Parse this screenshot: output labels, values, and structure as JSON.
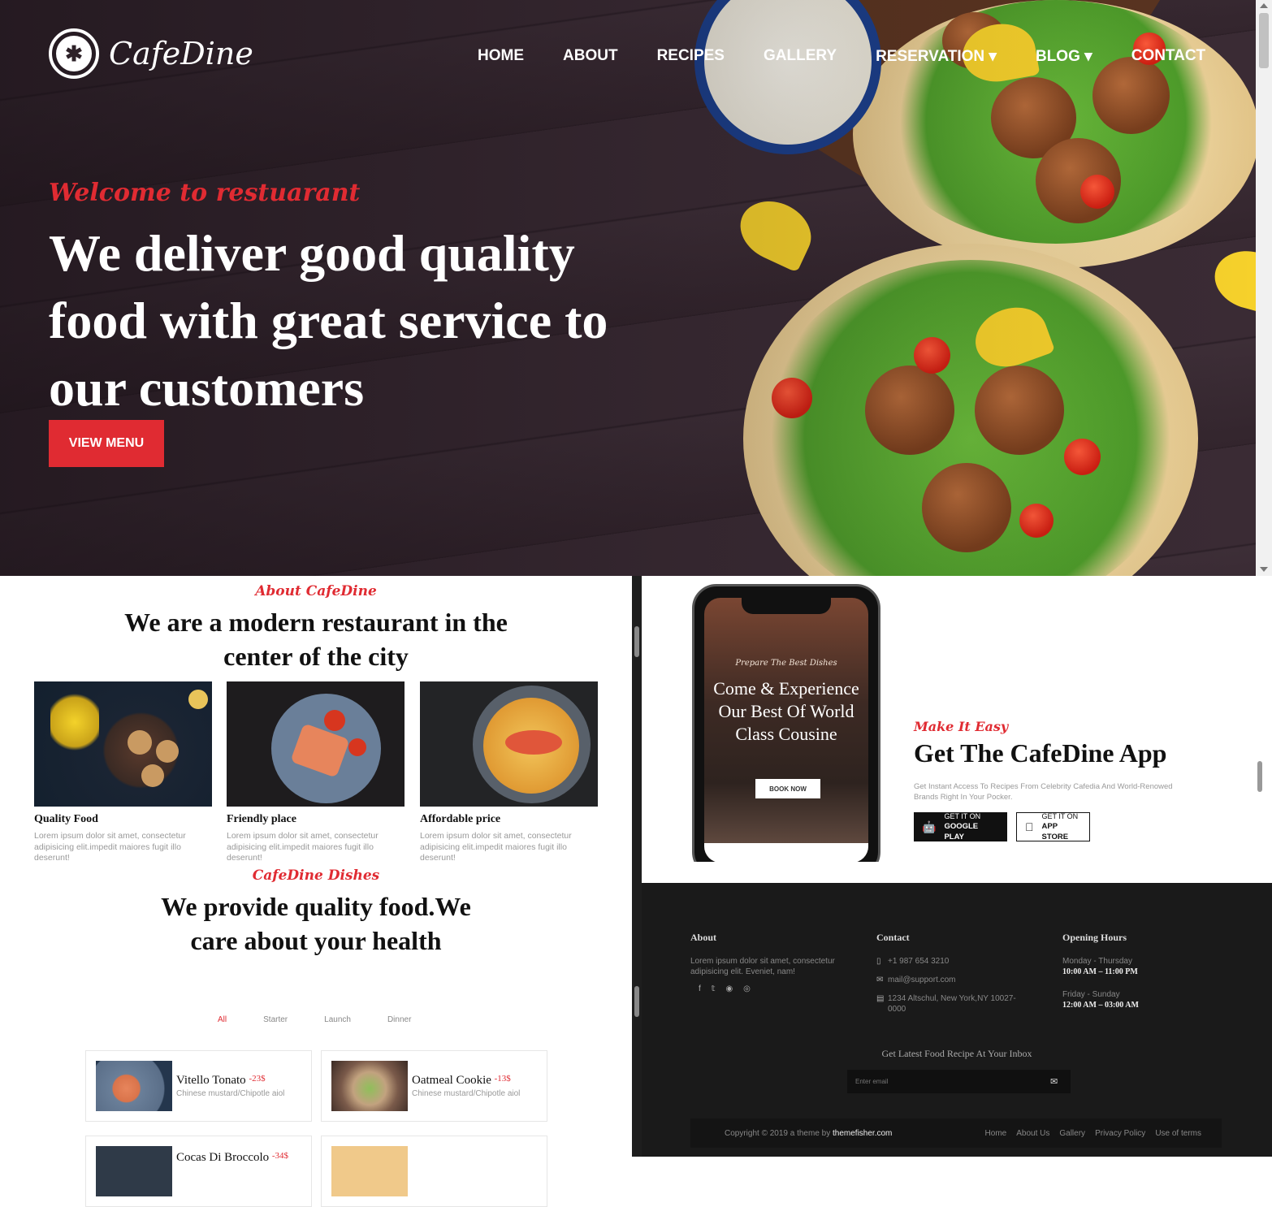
{
  "brand": {
    "name": "CafeDine",
    "accent": "#e02b32"
  },
  "nav": {
    "items": [
      "HOME",
      "ABOUT",
      "RECIPES",
      "GALLERY",
      "RESERVATION",
      "BLOG",
      "CONTACT"
    ]
  },
  "hero": {
    "welcome": "Welcome to restuarant",
    "title": "We deliver good quality food with great service to our customers",
    "cta": "VIEW MENU"
  },
  "about": {
    "subtitle": "About CafeDine",
    "title": "We are a modern restaurant in the center of the city",
    "features": [
      {
        "title": "Quality Food",
        "text": "Lorem ipsum dolor sit amet, consectetur adipisicing elit.impedit maiores fugit illo deserunt!"
      },
      {
        "title": "Friendly place",
        "text": "Lorem ipsum dolor sit amet, consectetur adipisicing elit.impedit maiores fugit illo deserunt!"
      },
      {
        "title": "Affordable price",
        "text": "Lorem ipsum dolor sit amet, consectetur adipisicing elit.impedit maiores fugit illo deserunt!"
      }
    ]
  },
  "dishes": {
    "subtitle": "CafeDine Dishes",
    "title": "We provide quality food.We care about your health",
    "tabs": [
      "All",
      "Starter",
      "Launch",
      "Dinner"
    ],
    "items": [
      {
        "name": "Vitello Tonato",
        "price": "-23$",
        "desc": "Chinese mustard/Chipotle aiol"
      },
      {
        "name": "Oatmeal Cookie",
        "price": "-13$",
        "desc": "Chinese mustard/Chipotle aiol"
      },
      {
        "name": "Cocas Di Broccolo",
        "price": "-34$",
        "desc": ""
      },
      {
        "name": "",
        "price": "",
        "desc": ""
      }
    ]
  },
  "app": {
    "phone_subtitle": "Prepare The Best Dishes",
    "phone_title": "Come & Experience Our Best Of World Class Cousine",
    "phone_button": "BOOK NOW",
    "subtitle": "Make It Easy",
    "title": "Get The CafeDine App",
    "desc": "Get Instant Access To Recipes From Celebrity Cafedia And World-Renowed Brands Right In Your Pocker.",
    "google": {
      "line1": "GET IT ON",
      "line2": "GOOGLE PLAY",
      "icon": "android-icon"
    },
    "apple": {
      "line1": "GET IT ON",
      "line2": "APP STORE",
      "icon": "apple-icon"
    }
  },
  "footer": {
    "about_title": "About",
    "about_text": "Lorem ipsum dolor sit amet, consectetur adipisicing elit. Eveniet, nam!",
    "social": [
      "facebook-icon",
      "twitter-icon",
      "github-icon",
      "dribbble-icon"
    ],
    "contact_title": "Contact",
    "phone": "+1 987 654 3210",
    "email": "mail@support.com",
    "address": "1234 Altschul, New York,NY 10027-0000",
    "hours_title": "Opening Hours",
    "hours": [
      {
        "days": "Monday - Thursday",
        "time": "10:00 AM – 11:00 PM"
      },
      {
        "days": "Friday - Sunday",
        "time": "12:00 AM – 03:00 AM"
      }
    ],
    "newsletter_title": "Get Latest Food Recipe At Your Inbox",
    "newsletter_placeholder": "Enter email",
    "copyright_prefix": "Copyright © 2019 a theme by",
    "copyright_author": "themefisher.com",
    "links": [
      "Home",
      "About Us",
      "Gallery",
      "Privacy Policy",
      "Use of terms"
    ]
  }
}
